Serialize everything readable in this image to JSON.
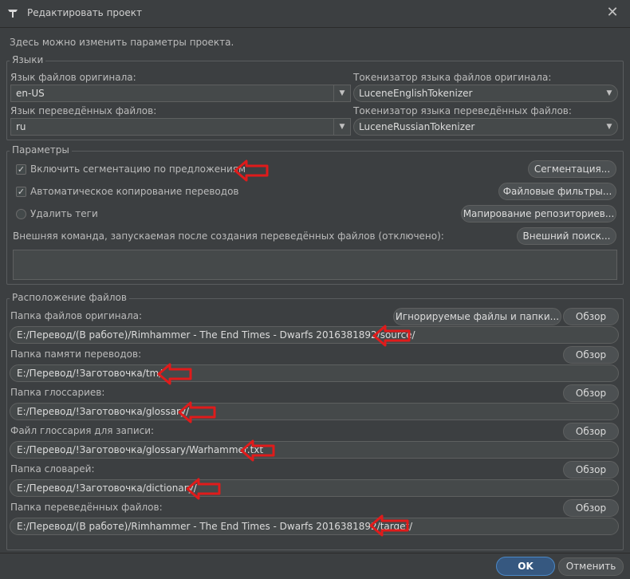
{
  "window": {
    "title": "Редактировать проект",
    "close_icon": "close-icon"
  },
  "intro": "Здесь можно изменить параметры проекта.",
  "languages": {
    "label": "Языки",
    "source_lang_label": "Язык файлов оригинала:",
    "source_lang_value": "en-US",
    "source_tokenizer_label": "Токенизатор языка файлов оригинала:",
    "source_tokenizer_value": "LuceneEnglishTokenizer",
    "target_lang_label": "Язык переведённых файлов:",
    "target_lang_value": "ru",
    "target_tokenizer_label": "Токенизатор языка переведённых файлов:",
    "target_tokenizer_value": "LuceneRussianTokenizer"
  },
  "params": {
    "label": "Параметры",
    "sentence_seg_label": "Включить сегментацию по предложениям",
    "sentence_seg_checked": true,
    "auto_copy_label": "Автоматическое копирование переводов",
    "auto_copy_checked": true,
    "remove_tags_label": "Удалить теги",
    "remove_tags_checked": false,
    "segmentation_button": "Сегментация...",
    "file_filters_button": "Файловые фильтры...",
    "repo_mapping_button": "Мапирование репозиториев...",
    "external_cmd_label": "Внешняя команда, запускаемая после создания переведённых файлов (отключено):",
    "external_search_button": "Внешний поиск...",
    "external_cmd_value": ""
  },
  "locations": {
    "label": "Расположение файлов",
    "ignored_files_button": "Игнорируемые файлы и папки...",
    "browse_label": "Обзор",
    "items": [
      {
        "label": "Папка файлов оригинала:",
        "value": "E:/Перевод/(В работе)/Rimhammer - The End Times - Dwarfs 2016381892/source/"
      },
      {
        "label": "Папка памяти переводов:",
        "value": "E:/Перевод/!Заготовочка/tm/"
      },
      {
        "label": "Папка глоссариев:",
        "value": "E:/Перевод/!Заготовочка/glossary/"
      },
      {
        "label": "Файл глоссария для записи:",
        "value": "E:/Перевод/!Заготовочка/glossary/Warhammer.txt"
      },
      {
        "label": "Папка словарей:",
        "value": "E:/Перевод/!Заготовочка/dictionary/"
      },
      {
        "label": "Папка переведённых файлов:",
        "value": "E:/Перевод/(В работе)/Rimhammer - The End Times - Dwarfs 2016381892/target/"
      }
    ]
  },
  "footer": {
    "ok_button": "OK",
    "cancel_button": "Отменить"
  },
  "colors": {
    "background": "#3c3f41",
    "accent": "#365880",
    "annotation_red": "#e01b1b"
  }
}
